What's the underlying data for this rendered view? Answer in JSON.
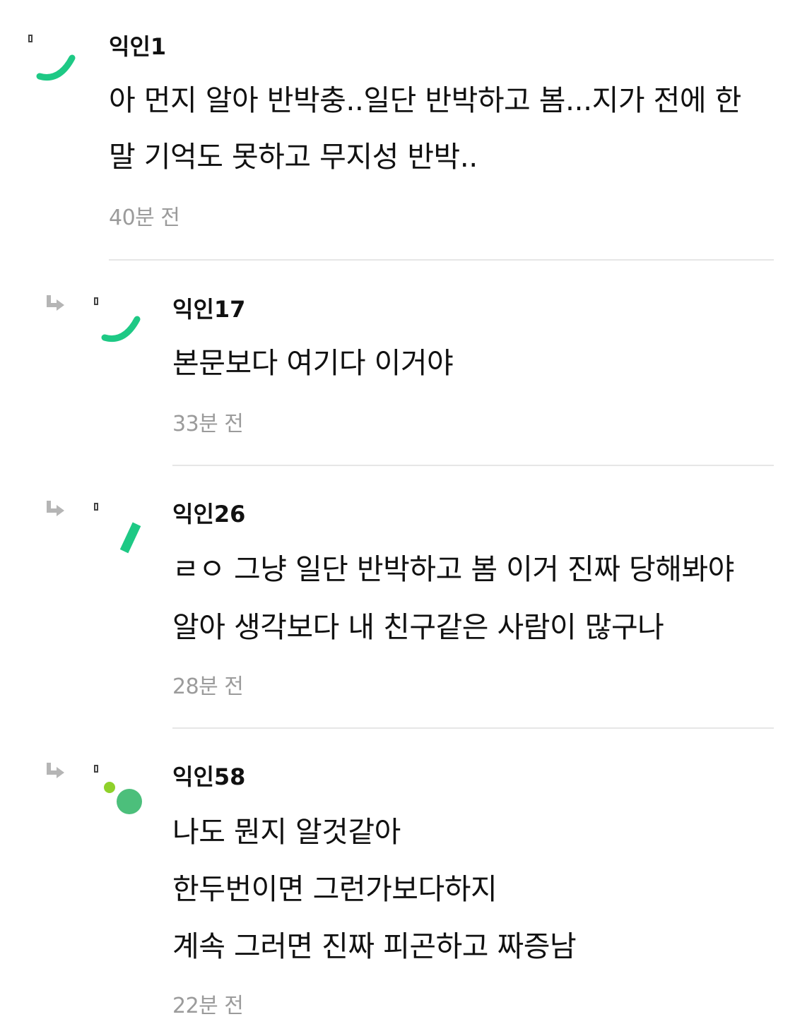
{
  "colors": {
    "accent_green": "#1ec985",
    "avatar_green": "#4cbf7b",
    "avatar_lime": "#8fd12a",
    "timestamp_gray": "#9b9b9b",
    "divider_gray": "#e6e6e6",
    "reply_arrow_gray": "#b5b5b5"
  },
  "comments": [
    {
      "author": "익인1",
      "lines": [
        "아 먼지 알아 반박충..일단 반박하고 봄...지가 전에 한",
        "말 기억도 못하고 무지성 반박.."
      ],
      "time": "40분 전",
      "is_reply": false,
      "avatar_icon": "green-arc-avatar-icon"
    },
    {
      "author": "익인17",
      "lines": [
        "본문보다 여기다 이거야"
      ],
      "time": "33분 전",
      "is_reply": true,
      "avatar_icon": "green-arc-avatar-icon"
    },
    {
      "author": "익인26",
      "lines": [
        "ㄹㅇ 그냥 일단 반박하고 봄 이거 진짜 당해봐야",
        "알아 생각보다 내 친구같은 사람이 많구나"
      ],
      "time": "28분 전",
      "is_reply": true,
      "avatar_icon": "green-slash-avatar-icon"
    },
    {
      "author": "익인58",
      "lines": [
        "나도 뭔지 알것같아",
        "한두번이면 그런가보다하지",
        "계속 그러면 진짜 피곤하고 짜증남"
      ],
      "time": "22분 전",
      "is_reply": true,
      "avatar_icon": "green-dots-avatar-icon"
    }
  ]
}
